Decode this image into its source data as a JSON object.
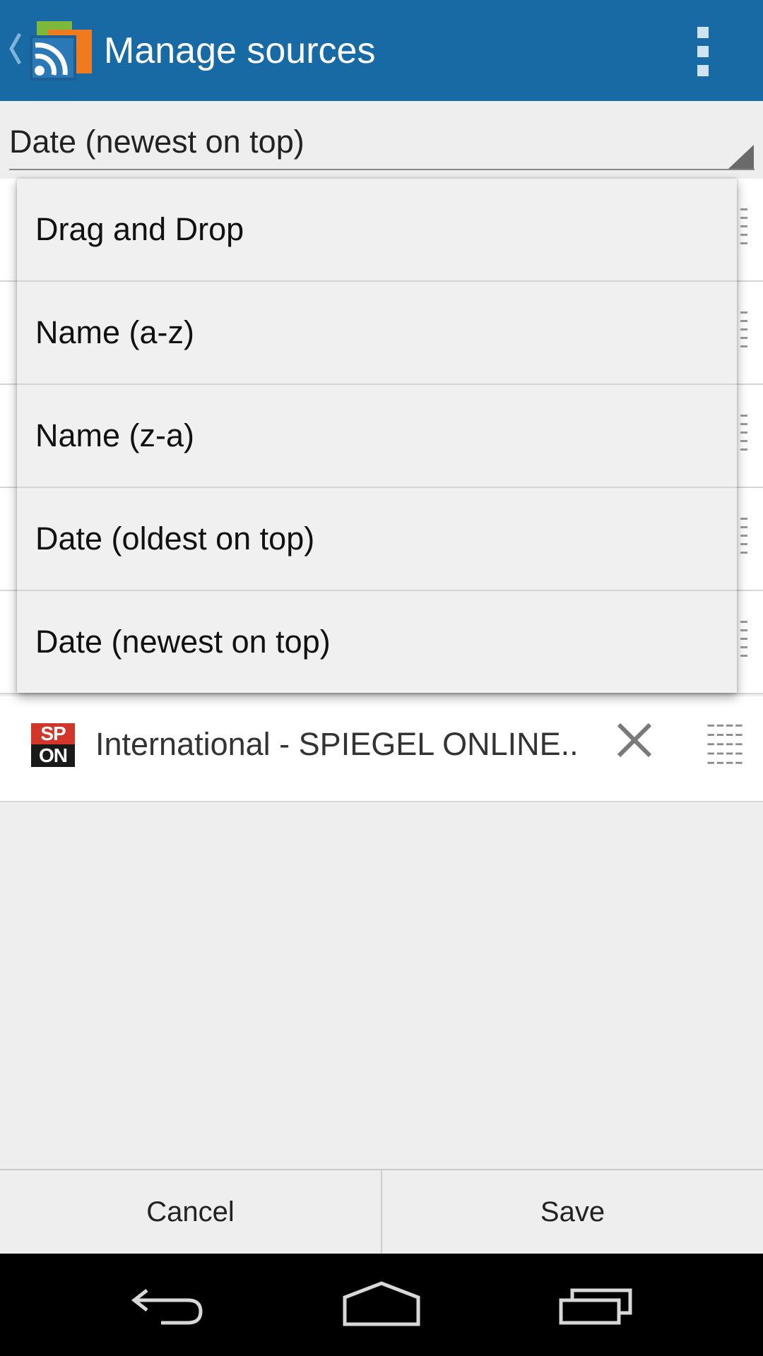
{
  "app_bar": {
    "title": "Manage sources",
    "up_icon": "chevron-left-icon",
    "app_icon": "rss-feed-pro-icon",
    "overflow_icon": "overflow-menu-icon",
    "color": "#176aa3"
  },
  "sort_spinner": {
    "selected": "Date (newest on top)",
    "arrow_icon": "dropdown-triangle-icon"
  },
  "sort_menu": {
    "options": [
      "Drag and Drop",
      "Name (a-z)",
      "Name (z-a)",
      "Date (oldest on top)",
      "Date (newest on top)"
    ]
  },
  "sources": [
    {
      "icon_text_top": "SP",
      "icon_text_bottom": "ON",
      "title": "International - SPIEGEL ONLINE..",
      "remove_icon": "close-icon",
      "drag_icon": "drag-handle-icon"
    }
  ],
  "buttons": {
    "cancel": "Cancel",
    "save": "Save"
  },
  "nav_bar": {
    "back_icon": "back-icon",
    "home_icon": "home-icon",
    "recents_icon": "recents-icon"
  }
}
